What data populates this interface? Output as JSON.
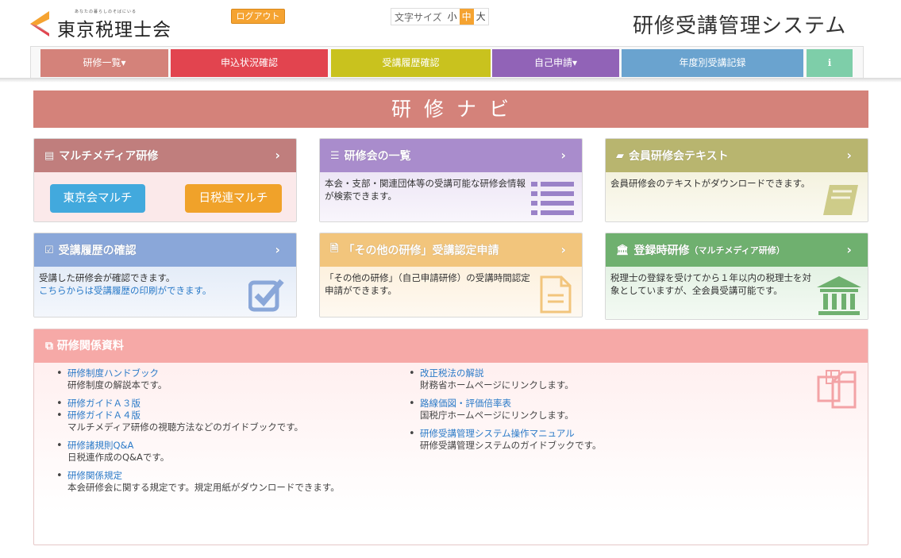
{
  "header": {
    "logo_tagline": "あなたの暮らしのそばにいる",
    "logo_text": "東京税理士会",
    "logout_label": "ログアウト",
    "font_size_label": "文字サイズ",
    "font_sizes": [
      "小",
      "中",
      "大"
    ],
    "system_title": "研修受講管理システム"
  },
  "nav": {
    "items": [
      {
        "label": "研修一覧▾",
        "color": "#d4827a"
      },
      {
        "label": "申込状況確認",
        "color": "#e2444f"
      },
      {
        "label": "受講履歴確認",
        "color": "#c9c21e"
      },
      {
        "label": "自己申請▾",
        "color": "#9163b7"
      },
      {
        "label": "年度別受講記録",
        "color": "#6aa3cf"
      },
      {
        "label": "ℹ",
        "color": "#7ecea9"
      }
    ]
  },
  "banner_title": "研修ナビ",
  "cards": {
    "multimedia": {
      "title": "マルチメディア研修",
      "btn_tokyo": "東京会マルチ",
      "btn_nichizei": "日税連マルチ"
    },
    "list": {
      "title": "研修会の一覧",
      "desc": "本会・支部・関連団体等の受講可能な研修会情報が検索できます。"
    },
    "text": {
      "title": "会員研修会テキスト",
      "desc": "会員研修会のテキストがダウンロードできます。"
    },
    "history": {
      "title": "受講履歴の確認",
      "desc1": "受講した研修会が確認できます。",
      "desc2": "こちらからは受講履歴の印刷ができます。"
    },
    "other": {
      "title": "「その他の研修」受講認定申請",
      "desc": "「その他の研修」（自己申請研修）の受講時間認定申請ができます。"
    },
    "register": {
      "title": "登録時研修",
      "title_sub": "（マルチメディア研修）",
      "desc": "税理士の登録を受けてから１年以内の税理士を対象としていますが、全会員受講可能です。"
    }
  },
  "resources": {
    "title": "研修関係資料",
    "left": [
      {
        "link": "研修制度ハンドブック",
        "desc": "研修制度の解説本です。"
      },
      {
        "link": "研修ガイドＡ３版",
        "desc": ""
      },
      {
        "link": "研修ガイドＡ４版",
        "desc": "マルチメディア研修の視聴方法などのガイドブックです。"
      },
      {
        "link": "研修諸規則Q&A",
        "desc": "日税連作成のQ&Aです。"
      },
      {
        "link": "研修関係規定",
        "desc": "本会研修会に関する規定です。規定用紙がダウンロードできます。"
      }
    ],
    "right": [
      {
        "link": "改正税法の解説",
        "desc": "財務省ホームページにリンクします。"
      },
      {
        "link": "路線価図・評価倍率表",
        "desc": "国税庁ホームページにリンクします。"
      },
      {
        "link": "研修受講管理システム操作マニュアル",
        "desc": "研修受講管理システムのガイドブックです。"
      }
    ]
  }
}
